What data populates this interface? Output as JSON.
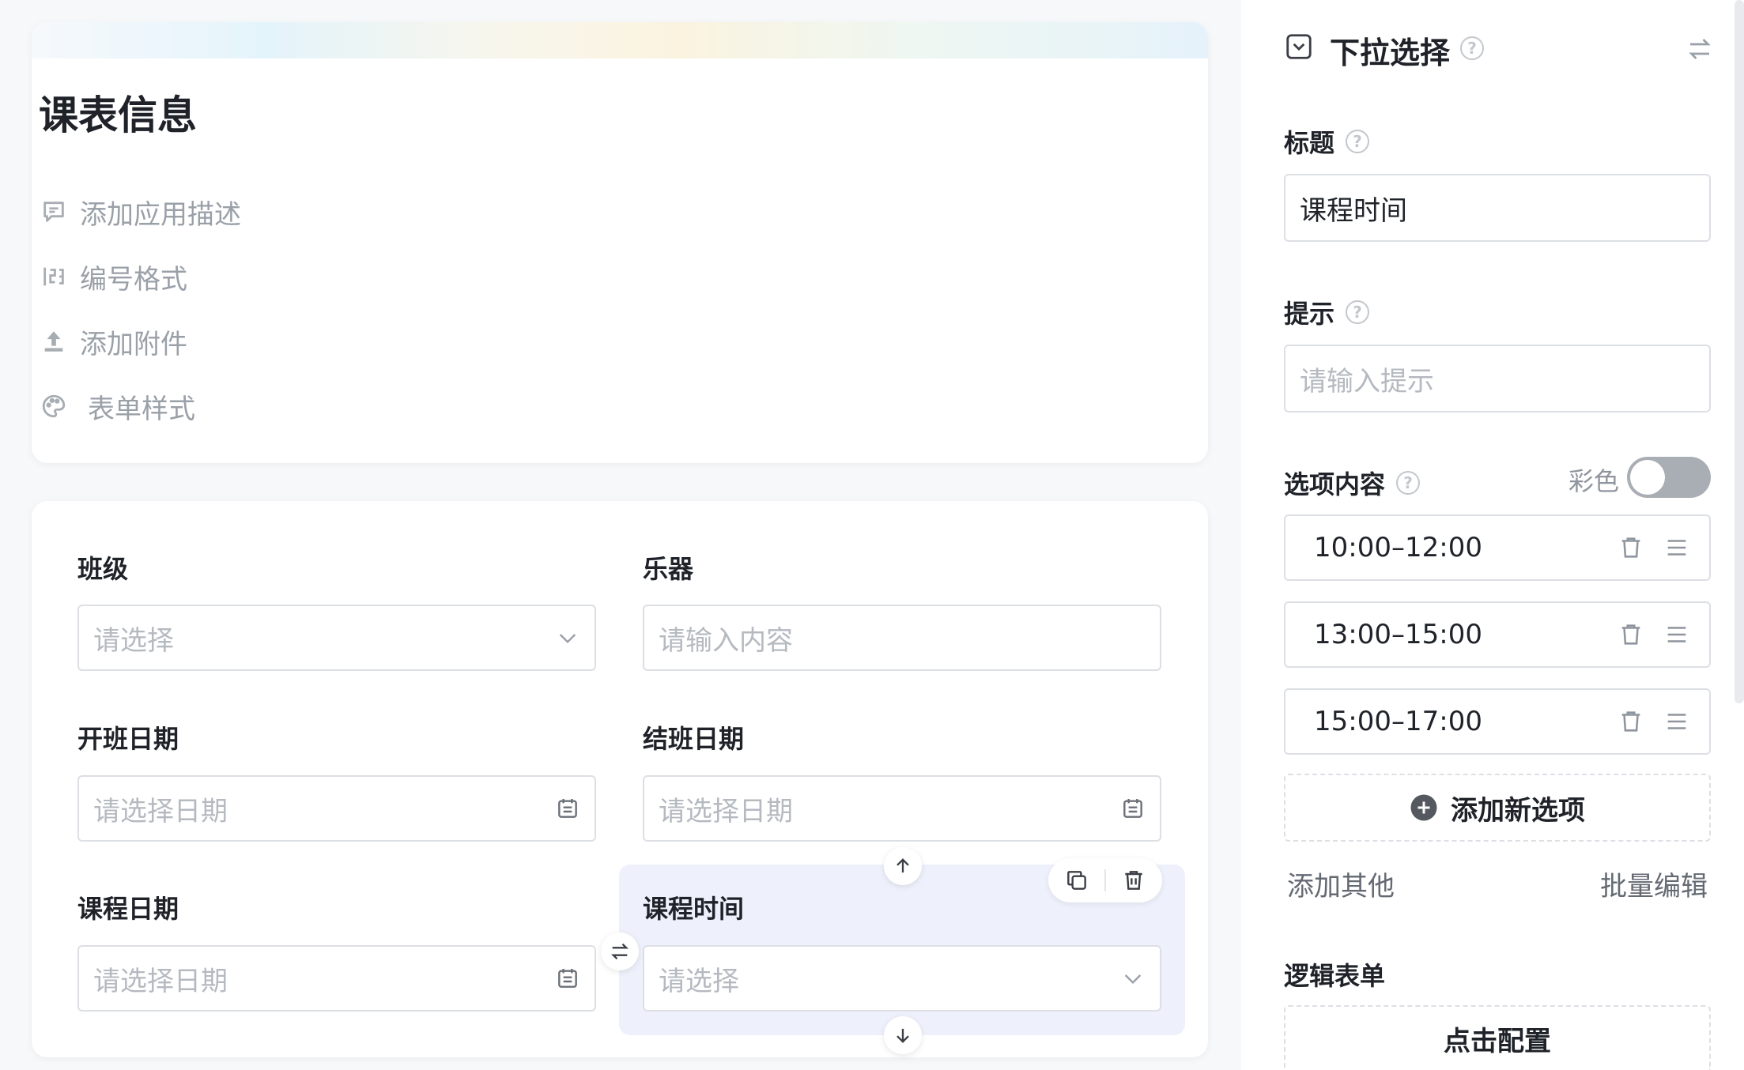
{
  "form": {
    "title": "课表信息",
    "meta": [
      {
        "label": "添加应用描述",
        "icon": "comment-icon"
      },
      {
        "label": "编号格式",
        "icon": "number-format-icon"
      },
      {
        "label": "添加附件",
        "icon": "upload-icon"
      },
      {
        "label": "表单样式",
        "icon": "palette-icon"
      }
    ]
  },
  "fields": {
    "class": {
      "label": "班级",
      "placeholder": "请选择"
    },
    "instrument": {
      "label": "乐器",
      "placeholder": "请输入内容"
    },
    "start_date": {
      "label": "开班日期",
      "placeholder": "请选择日期"
    },
    "end_date": {
      "label": "结班日期",
      "placeholder": "请选择日期"
    },
    "course_date": {
      "label": "课程日期",
      "placeholder": "请选择日期"
    },
    "course_time": {
      "label": "课程时间",
      "placeholder": "请选择"
    }
  },
  "panel": {
    "title": "下拉选择",
    "title_label": "标题",
    "title_value": "课程时间",
    "hint_label": "提示",
    "hint_placeholder": "请输入提示",
    "options_label": "选项内容",
    "color_label": "彩色",
    "color_enabled": false,
    "options": [
      "10:00–12:00",
      "13:00–15:00",
      "15:00–17:00"
    ],
    "add_option": "添加新选项",
    "add_other": "添加其他",
    "batch_edit": "批量编辑",
    "logic_label": "逻辑表单",
    "logic_button": "点击配置"
  }
}
